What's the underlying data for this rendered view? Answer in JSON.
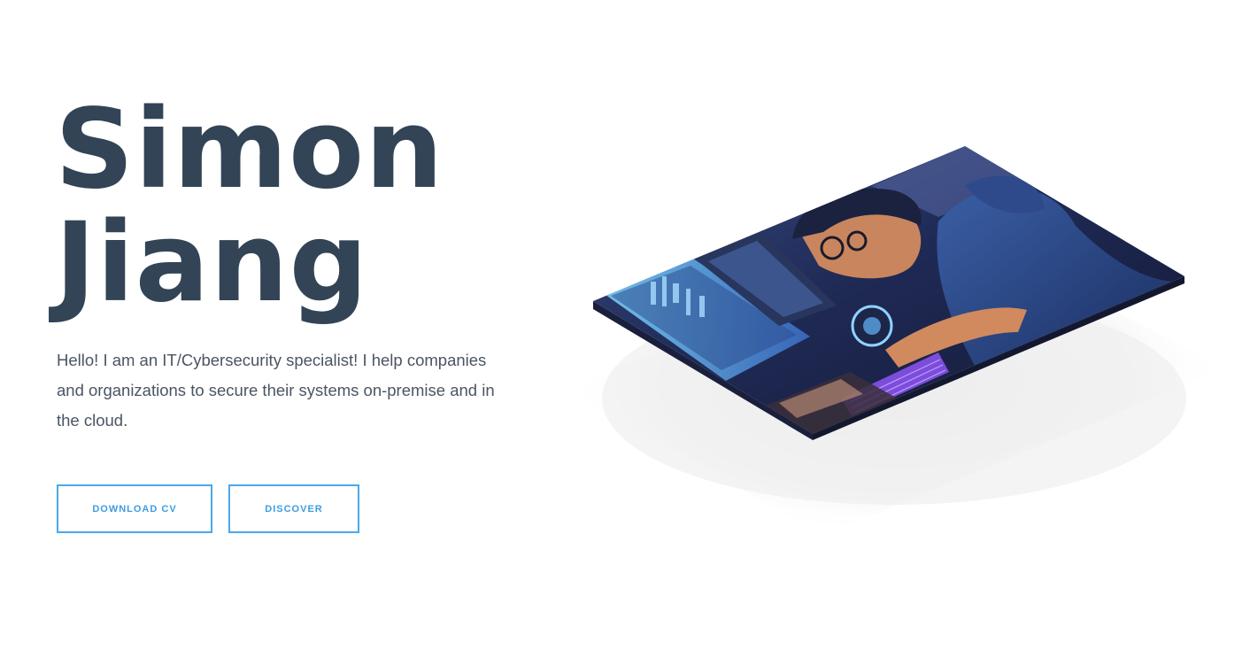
{
  "hero": {
    "title_line1": "Simon",
    "title_line2": "Jiang",
    "description": "Hello! I am an IT/Cybersecurity specialist! I help companies and organizations to secure their systems on-premise and in the cloud."
  },
  "buttons": {
    "download_cv": "DOWNLOAD CV",
    "discover": "DISCOVER"
  },
  "colors": {
    "title": "#324456",
    "accent": "#4aa8ea",
    "text": "#4a5563"
  },
  "image": {
    "icon": "isometric-illustration-icon"
  }
}
